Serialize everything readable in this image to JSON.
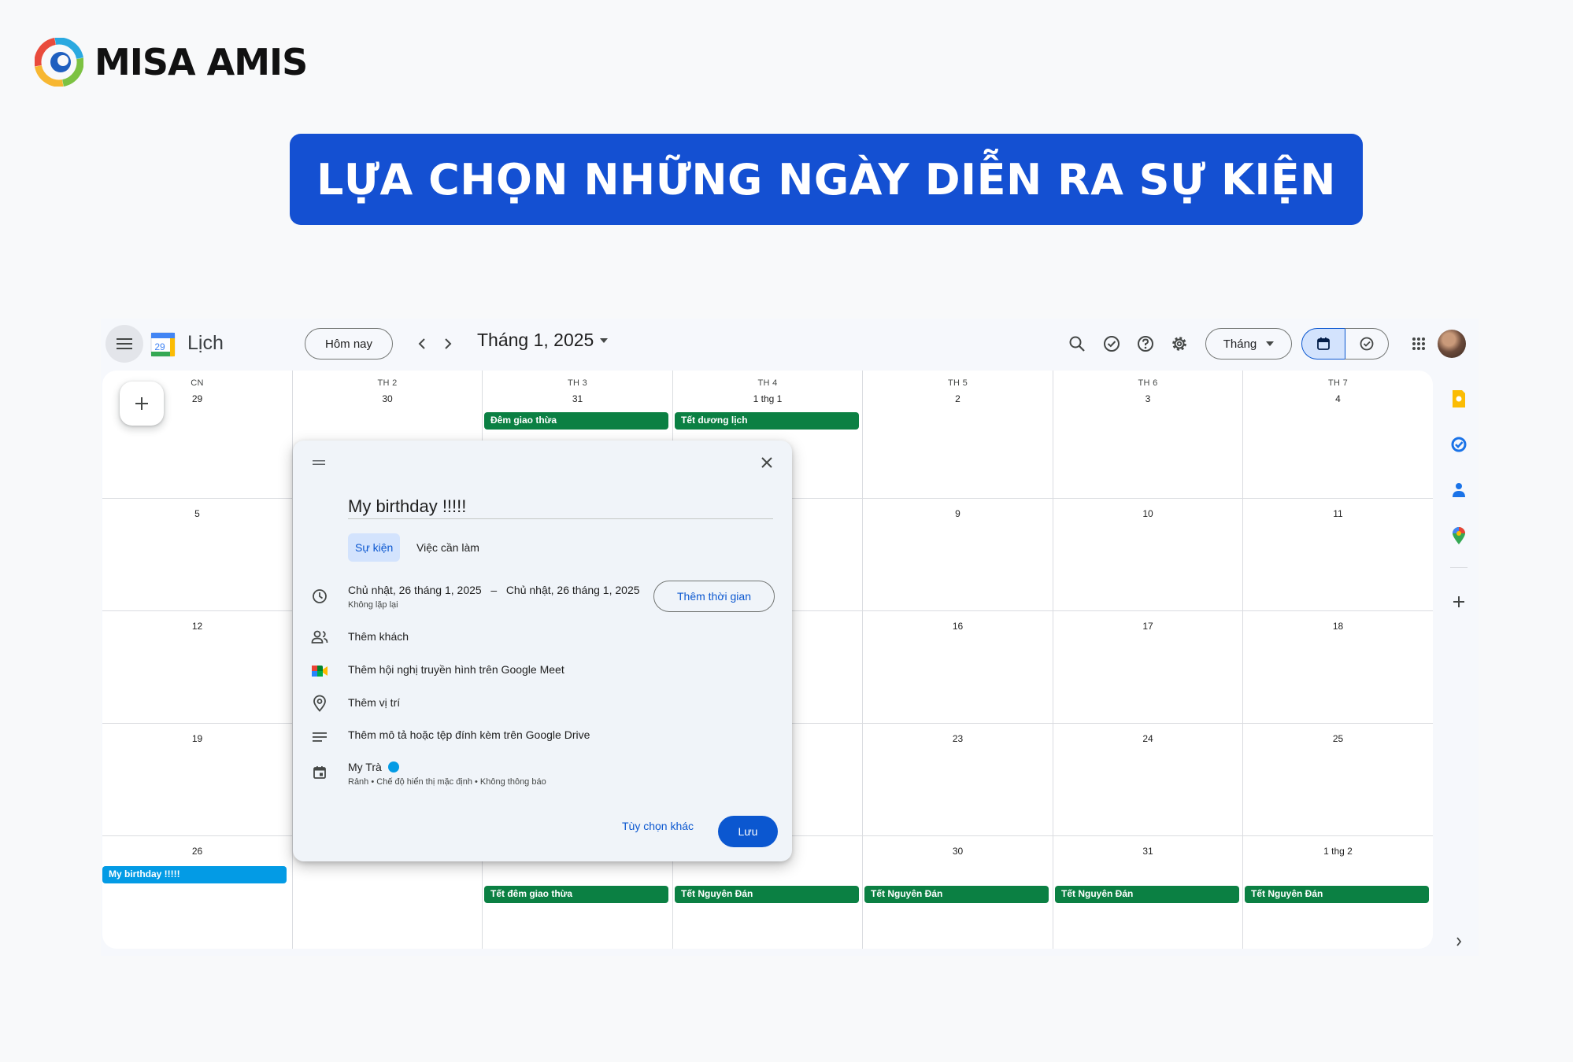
{
  "brand": {
    "name": "MISA AMIS"
  },
  "banner": {
    "title": "LỰA CHỌN NHỮNG NGÀY DIỄN RA SỰ KIỆN"
  },
  "topbar": {
    "app_name": "Lịch",
    "logo_day": "29",
    "today_label": "Hôm nay",
    "month_title": "Tháng 1, 2025",
    "view_label": "Tháng",
    "icons": [
      "menu-icon",
      "chevron-left-icon",
      "chevron-right-icon",
      "search-icon",
      "check-circle-icon",
      "help-icon",
      "gear-icon",
      "calendar-icon",
      "task-icon",
      "apps-grid-icon"
    ]
  },
  "grid": {
    "weekdays": [
      {
        "dow": "CN",
        "date": "29"
      },
      {
        "dow": "TH 2",
        "date": "30"
      },
      {
        "dow": "TH 3",
        "date": "31"
      },
      {
        "dow": "TH 4",
        "date": "1 thg 1"
      },
      {
        "dow": "TH 5",
        "date": "2"
      },
      {
        "dow": "TH 6",
        "date": "3"
      },
      {
        "dow": "TH 7",
        "date": "4"
      }
    ],
    "weeks": [
      [
        "5",
        "",
        "",
        "",
        "9",
        "10",
        "11"
      ],
      [
        "12",
        "",
        "",
        "",
        "16",
        "17",
        "18"
      ],
      [
        "19",
        "",
        "",
        "",
        "23",
        "24",
        "25"
      ],
      [
        "26",
        "",
        "",
        "",
        "30",
        "31",
        "1 thg 2"
      ]
    ],
    "events_row1": [
      {
        "col": 2,
        "label": "Đêm giao thừa"
      },
      {
        "col": 3,
        "label": "Tết dương lịch"
      }
    ],
    "events_row5": [
      {
        "col": 0,
        "label": "My birthday !!!!!",
        "color": "#039be5"
      },
      {
        "col": 2,
        "label": "Tết đêm giao thừa"
      },
      {
        "col": 3,
        "label": "Tết Nguyên Đán"
      },
      {
        "col": 4,
        "label": "Tết Nguyên Đán"
      },
      {
        "col": 5,
        "label": "Tết Nguyên Đán"
      },
      {
        "col": 6,
        "label": "Tết Nguyên Đán"
      }
    ]
  },
  "colors": {
    "accent": "#0b57d0",
    "holiday": "#0b8043",
    "event": "#039be5",
    "banner": "#1450d2"
  },
  "dialog": {
    "title_value": "My birthday !!!!!",
    "tab_event": "Sự kiện",
    "tab_task": "Việc cần làm",
    "date_range": "Chủ nhật, 26 tháng 1, 2025   –   Chủ nhật, 26 tháng 1, 2025",
    "repeat": "Không lặp lại",
    "add_time": "Thêm thời gian",
    "add_guests": "Thêm khách",
    "add_meet": "Thêm hội nghị truyền hình trên Google Meet",
    "add_location": "Thêm vị trí",
    "add_description": "Thêm mô tả hoặc tệp đính kèm trên Google Drive",
    "calendar_name": "My Trà",
    "calendar_sub": "Rảnh • Chế độ hiển thị mặc định • Không thông báo",
    "more_options": "Tùy chọn khác",
    "save": "Lưu"
  }
}
